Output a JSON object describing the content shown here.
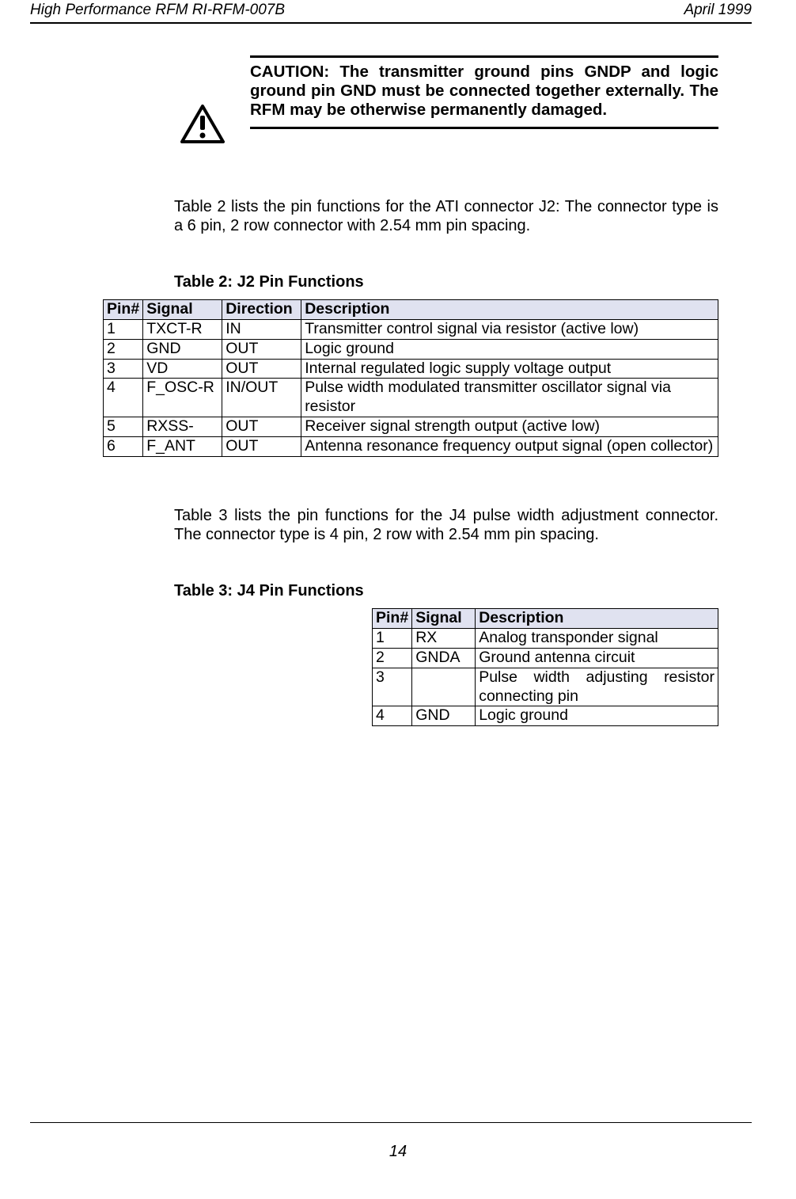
{
  "header": {
    "left": "High Performance RFM RI-RFM-007B",
    "right": "April 1999"
  },
  "caution": "CAUTION: The transmitter ground pins GNDP and logic ground pin GND must be connected together externally. The RFM may be otherwise permanently damaged.",
  "para_t2": "Table 2 lists the pin functions for the ATI connector J2: The connector type is a 6 pin, 2 row connector with 2.54 mm pin spacing.",
  "table2": {
    "caption": "Table 2: J2 Pin Functions",
    "headers": {
      "pin": "Pin#",
      "signal": "Signal",
      "direction": "Direction",
      "description": "Description"
    },
    "rows": [
      {
        "pin": "1",
        "signal": "TXCT-R",
        "direction": "IN",
        "description": "Transmitter control signal via resistor (active low)"
      },
      {
        "pin": "2",
        "signal": "GND",
        "direction": "OUT",
        "description": "Logic ground"
      },
      {
        "pin": "3",
        "signal": "VD",
        "direction": "OUT",
        "description": "Internal regulated logic supply voltage output"
      },
      {
        "pin": "4",
        "signal": "F_OSC-R",
        "direction": "IN/OUT",
        "description": "Pulse width modulated transmitter oscillator signal via resistor"
      },
      {
        "pin": "5",
        "signal": "RXSS-",
        "direction": "OUT",
        "description": "Receiver signal strength output (active low)"
      },
      {
        "pin": "6",
        "signal": "F_ANT",
        "direction": "OUT",
        "description": "Antenna resonance frequency output signal (open collector)"
      }
    ]
  },
  "para_t3": "Table 3 lists the pin functions for the J4 pulse width adjustment connector. The connector type is 4 pin, 2 row with 2.54 mm pin spacing.",
  "table3": {
    "caption": "Table 3: J4 Pin Functions",
    "headers": {
      "pin": "Pin#",
      "signal": "Signal",
      "description": "Description"
    },
    "rows": [
      {
        "pin": "1",
        "signal": "RX",
        "description": "Analog transponder signal"
      },
      {
        "pin": "2",
        "signal": "GNDA",
        "description": "Ground antenna circuit"
      },
      {
        "pin": "3",
        "signal": "",
        "description": "Pulse width adjusting resistor connecting pin"
      },
      {
        "pin": "4",
        "signal": "GND",
        "description": "Logic ground"
      }
    ]
  },
  "page_number": "14"
}
